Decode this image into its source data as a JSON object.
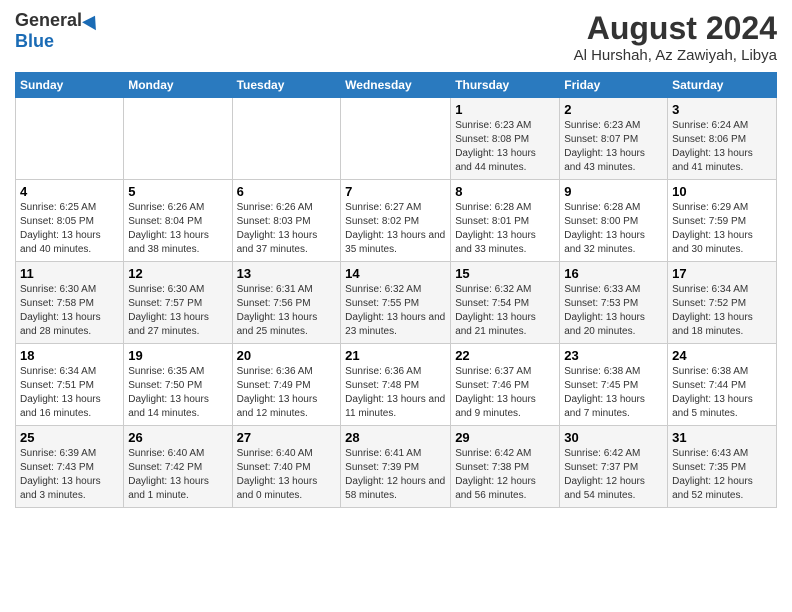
{
  "logo": {
    "general": "General",
    "blue": "Blue"
  },
  "title": "August 2024",
  "subtitle": "Al Hurshah, Az Zawiyah, Libya",
  "weekdays": [
    "Sunday",
    "Monday",
    "Tuesday",
    "Wednesday",
    "Thursday",
    "Friday",
    "Saturday"
  ],
  "weeks": [
    [
      {
        "day": "",
        "info": ""
      },
      {
        "day": "",
        "info": ""
      },
      {
        "day": "",
        "info": ""
      },
      {
        "day": "",
        "info": ""
      },
      {
        "day": "1",
        "info": "Sunrise: 6:23 AM\nSunset: 8:08 PM\nDaylight: 13 hours and 44 minutes."
      },
      {
        "day": "2",
        "info": "Sunrise: 6:23 AM\nSunset: 8:07 PM\nDaylight: 13 hours and 43 minutes."
      },
      {
        "day": "3",
        "info": "Sunrise: 6:24 AM\nSunset: 8:06 PM\nDaylight: 13 hours and 41 minutes."
      }
    ],
    [
      {
        "day": "4",
        "info": "Sunrise: 6:25 AM\nSunset: 8:05 PM\nDaylight: 13 hours and 40 minutes."
      },
      {
        "day": "5",
        "info": "Sunrise: 6:26 AM\nSunset: 8:04 PM\nDaylight: 13 hours and 38 minutes."
      },
      {
        "day": "6",
        "info": "Sunrise: 6:26 AM\nSunset: 8:03 PM\nDaylight: 13 hours and 37 minutes."
      },
      {
        "day": "7",
        "info": "Sunrise: 6:27 AM\nSunset: 8:02 PM\nDaylight: 13 hours and 35 minutes."
      },
      {
        "day": "8",
        "info": "Sunrise: 6:28 AM\nSunset: 8:01 PM\nDaylight: 13 hours and 33 minutes."
      },
      {
        "day": "9",
        "info": "Sunrise: 6:28 AM\nSunset: 8:00 PM\nDaylight: 13 hours and 32 minutes."
      },
      {
        "day": "10",
        "info": "Sunrise: 6:29 AM\nSunset: 7:59 PM\nDaylight: 13 hours and 30 minutes."
      }
    ],
    [
      {
        "day": "11",
        "info": "Sunrise: 6:30 AM\nSunset: 7:58 PM\nDaylight: 13 hours and 28 minutes."
      },
      {
        "day": "12",
        "info": "Sunrise: 6:30 AM\nSunset: 7:57 PM\nDaylight: 13 hours and 27 minutes."
      },
      {
        "day": "13",
        "info": "Sunrise: 6:31 AM\nSunset: 7:56 PM\nDaylight: 13 hours and 25 minutes."
      },
      {
        "day": "14",
        "info": "Sunrise: 6:32 AM\nSunset: 7:55 PM\nDaylight: 13 hours and 23 minutes."
      },
      {
        "day": "15",
        "info": "Sunrise: 6:32 AM\nSunset: 7:54 PM\nDaylight: 13 hours and 21 minutes."
      },
      {
        "day": "16",
        "info": "Sunrise: 6:33 AM\nSunset: 7:53 PM\nDaylight: 13 hours and 20 minutes."
      },
      {
        "day": "17",
        "info": "Sunrise: 6:34 AM\nSunset: 7:52 PM\nDaylight: 13 hours and 18 minutes."
      }
    ],
    [
      {
        "day": "18",
        "info": "Sunrise: 6:34 AM\nSunset: 7:51 PM\nDaylight: 13 hours and 16 minutes."
      },
      {
        "day": "19",
        "info": "Sunrise: 6:35 AM\nSunset: 7:50 PM\nDaylight: 13 hours and 14 minutes."
      },
      {
        "day": "20",
        "info": "Sunrise: 6:36 AM\nSunset: 7:49 PM\nDaylight: 13 hours and 12 minutes."
      },
      {
        "day": "21",
        "info": "Sunrise: 6:36 AM\nSunset: 7:48 PM\nDaylight: 13 hours and 11 minutes."
      },
      {
        "day": "22",
        "info": "Sunrise: 6:37 AM\nSunset: 7:46 PM\nDaylight: 13 hours and 9 minutes."
      },
      {
        "day": "23",
        "info": "Sunrise: 6:38 AM\nSunset: 7:45 PM\nDaylight: 13 hours and 7 minutes."
      },
      {
        "day": "24",
        "info": "Sunrise: 6:38 AM\nSunset: 7:44 PM\nDaylight: 13 hours and 5 minutes."
      }
    ],
    [
      {
        "day": "25",
        "info": "Sunrise: 6:39 AM\nSunset: 7:43 PM\nDaylight: 13 hours and 3 minutes."
      },
      {
        "day": "26",
        "info": "Sunrise: 6:40 AM\nSunset: 7:42 PM\nDaylight: 13 hours and 1 minute."
      },
      {
        "day": "27",
        "info": "Sunrise: 6:40 AM\nSunset: 7:40 PM\nDaylight: 13 hours and 0 minutes."
      },
      {
        "day": "28",
        "info": "Sunrise: 6:41 AM\nSunset: 7:39 PM\nDaylight: 12 hours and 58 minutes."
      },
      {
        "day": "29",
        "info": "Sunrise: 6:42 AM\nSunset: 7:38 PM\nDaylight: 12 hours and 56 minutes."
      },
      {
        "day": "30",
        "info": "Sunrise: 6:42 AM\nSunset: 7:37 PM\nDaylight: 12 hours and 54 minutes."
      },
      {
        "day": "31",
        "info": "Sunrise: 6:43 AM\nSunset: 7:35 PM\nDaylight: 12 hours and 52 minutes."
      }
    ]
  ]
}
